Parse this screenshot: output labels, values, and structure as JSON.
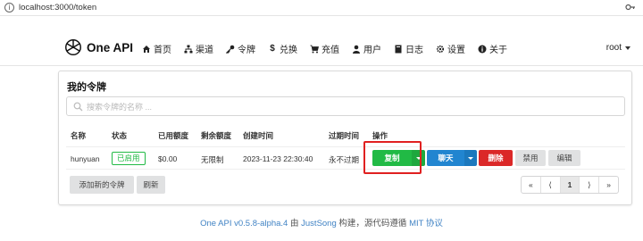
{
  "browser": {
    "url": "localhost:3000/token"
  },
  "nav": {
    "brand": "One API",
    "items": [
      {
        "label": "首页",
        "icon": "home-icon"
      },
      {
        "label": "渠道",
        "icon": "sitemap-icon"
      },
      {
        "label": "令牌",
        "icon": "key-icon"
      },
      {
        "label": "兑换",
        "icon": "dollar-icon"
      },
      {
        "label": "充值",
        "icon": "cart-icon"
      },
      {
        "label": "用户",
        "icon": "user-icon"
      },
      {
        "label": "日志",
        "icon": "book-icon"
      },
      {
        "label": "设置",
        "icon": "gear-icon"
      },
      {
        "label": "关于",
        "icon": "info-icon"
      }
    ],
    "user": "root"
  },
  "card": {
    "title": "我的令牌",
    "search_placeholder": "搜索令牌的名称 ...",
    "columns": [
      "名称",
      "状态",
      "已用额度",
      "剩余额度",
      "创建时间",
      "过期时间",
      "操作"
    ],
    "rows": [
      {
        "name": "hunyuan",
        "status": "已启用",
        "used": "$0.00",
        "remaining": "无限制",
        "created": "2023-11-23 22:30:40",
        "expires": "永不过期"
      }
    ],
    "actions": {
      "copy": "复制",
      "chat": "聊天",
      "delete": "删除",
      "disable": "禁用",
      "edit": "编辑"
    },
    "add_button": "添加新的令牌",
    "refresh_button": "刷新",
    "pagination": {
      "first": "«",
      "prev": "⟨",
      "current": "1",
      "next": "⟩",
      "last": "»"
    }
  },
  "footer": {
    "version": "One API v0.5.8-alpha.4",
    "by": "由",
    "author": "JustSong",
    "mid": "构建，源代码遵循",
    "license": "MIT 协议"
  },
  "colors": {
    "green": "#21ba45",
    "blue": "#2185d0",
    "red": "#db2828",
    "link": "#4183c4",
    "highlight": "#e02020"
  }
}
